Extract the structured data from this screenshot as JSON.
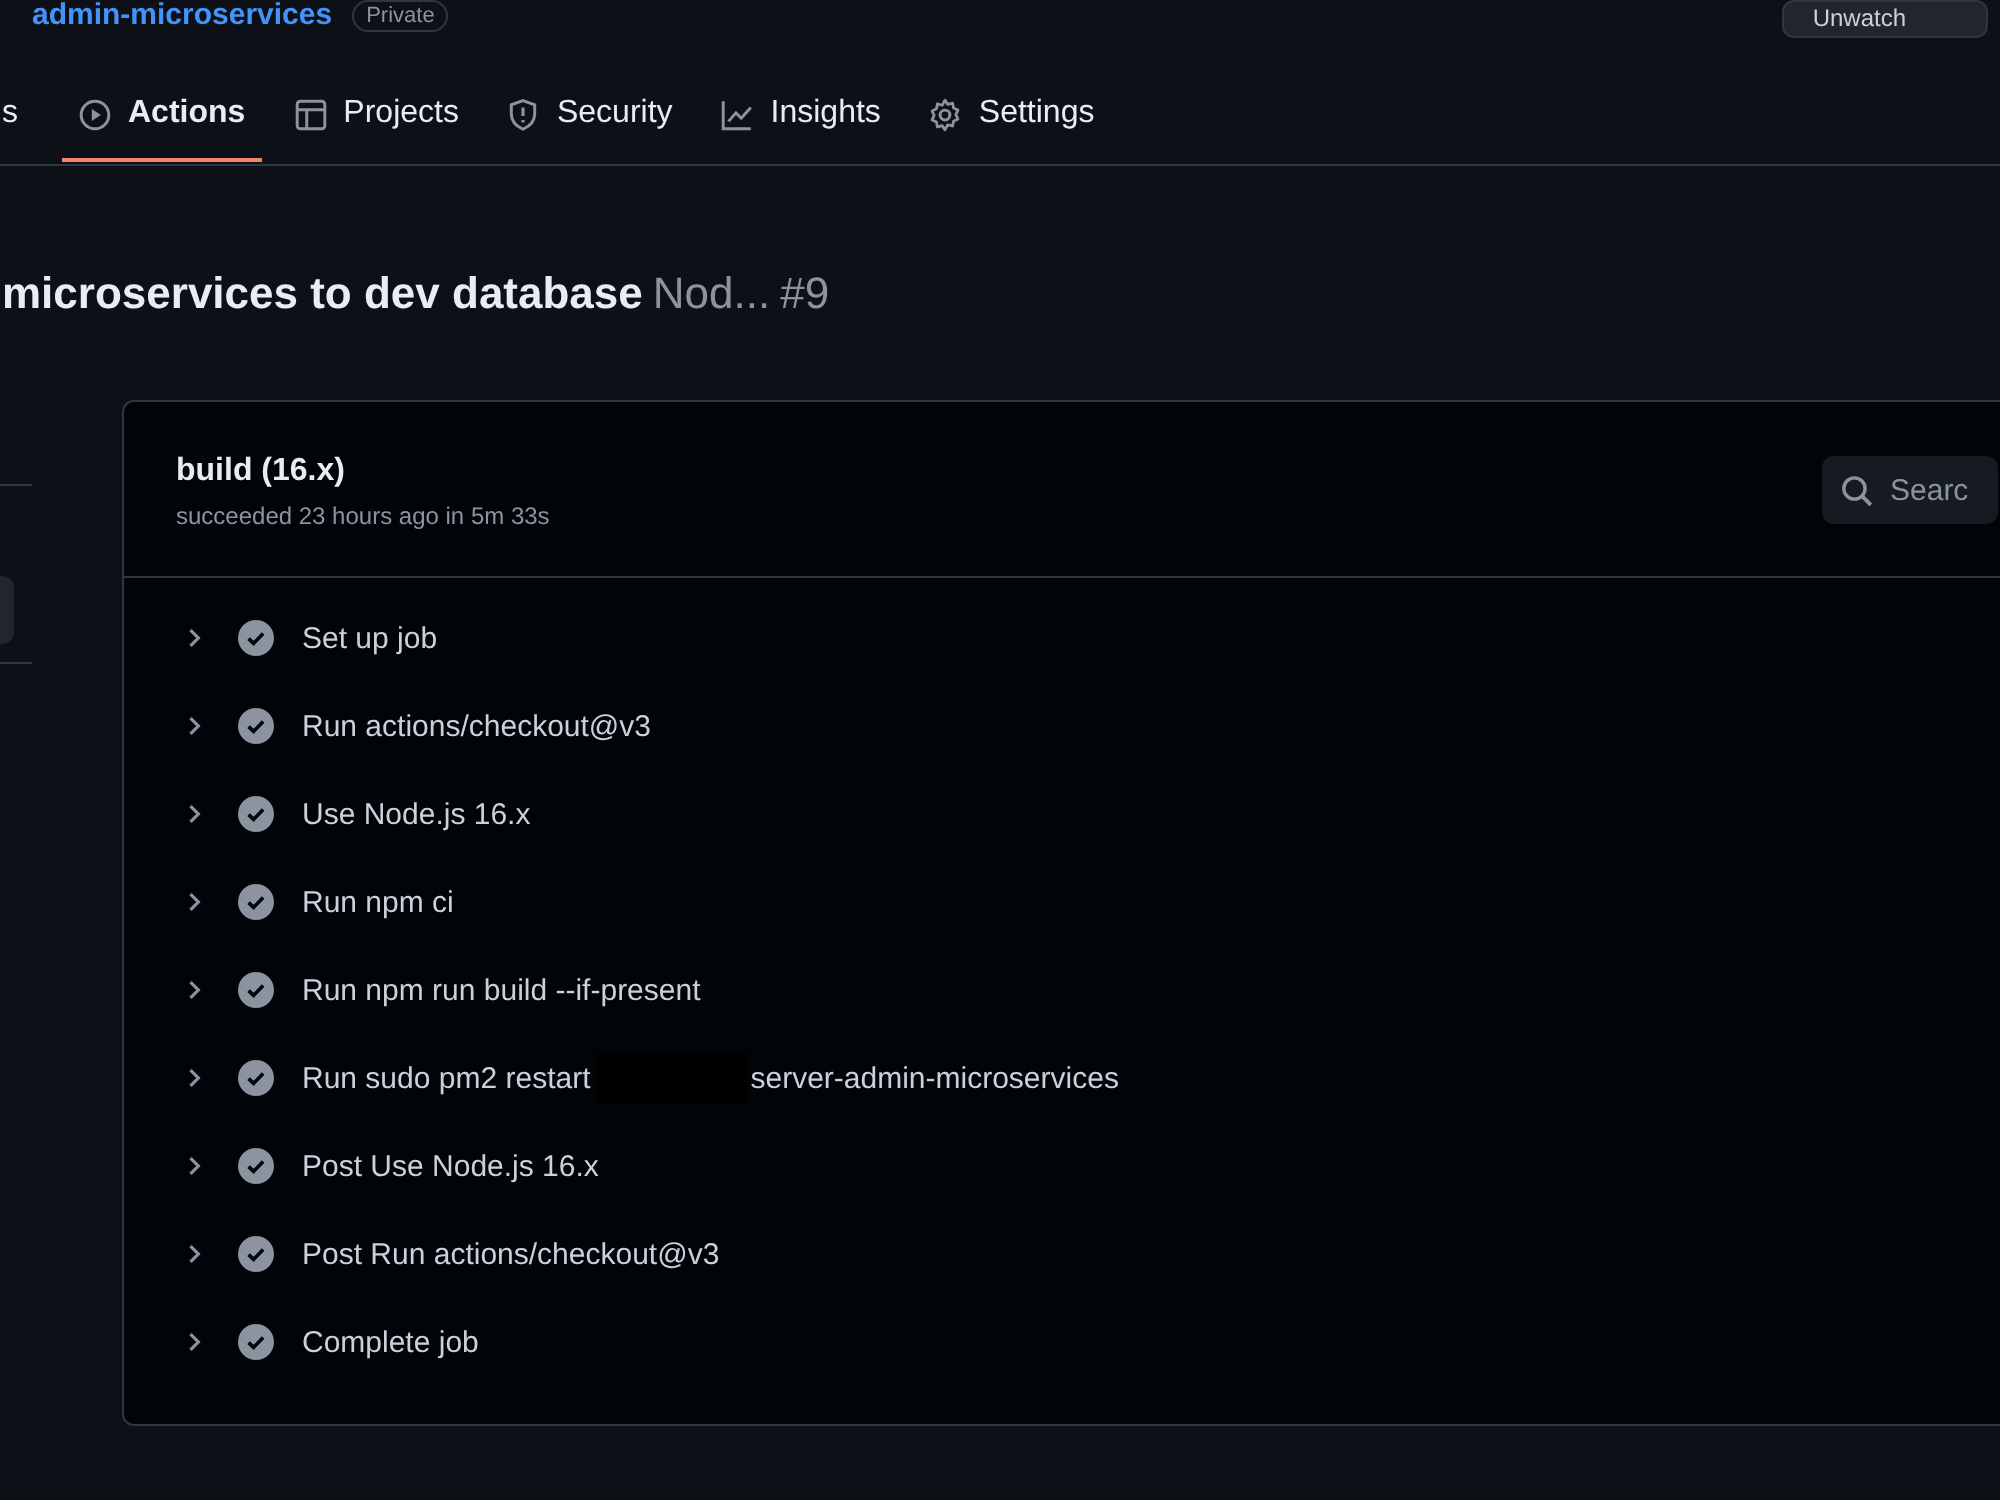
{
  "repo": {
    "name": "admin-microservices",
    "badge": "Private",
    "watch_button": "Unwatch"
  },
  "tabs": [
    {
      "label": "s",
      "selected": false
    },
    {
      "label": "Actions",
      "selected": true
    },
    {
      "label": "Projects",
      "selected": false
    },
    {
      "label": "Security",
      "selected": false
    },
    {
      "label": "Insights",
      "selected": false
    },
    {
      "label": "Settings",
      "selected": false
    }
  ],
  "run": {
    "title": "microservices to dev database",
    "workflow": "Nod...",
    "number": "#9"
  },
  "job": {
    "name": "build (16.x)",
    "status": "succeeded 23 hours ago in 5m 33s",
    "search": {
      "placeholder": "Searc"
    },
    "steps": [
      {
        "name": "Set up job",
        "expanded": false
      },
      {
        "name": "Run actions/checkout@v3",
        "expanded": false
      },
      {
        "name": "Use Node.js 16.x",
        "expanded": false
      },
      {
        "name": "Run npm ci",
        "expanded": false
      },
      {
        "name": "Run npm run build --if-present",
        "expanded": false
      },
      {
        "name": "Run sudo pm2 restart",
        "suffix": "server-admin-microservices",
        "expanded": false
      },
      {
        "name": "Post Use Node.js 16.x",
        "expanded": false
      },
      {
        "name": "Post Run actions/checkout@v3",
        "expanded": false
      },
      {
        "name": "Complete job",
        "expanded": false
      }
    ]
  }
}
